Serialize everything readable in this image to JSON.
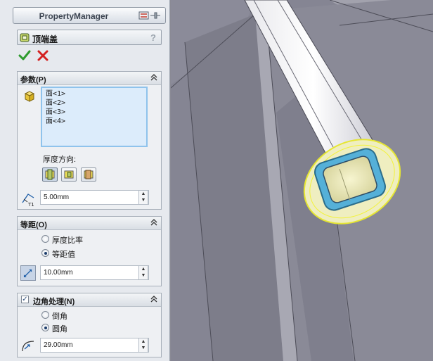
{
  "property_manager": {
    "title": "PropertyManager",
    "feature_title": "顶端盖",
    "help": "?",
    "ok_icon": "checkmark-icon",
    "cancel_icon": "x-icon"
  },
  "params_group": {
    "title": "参数(P)",
    "faces": [
      "面<1>",
      "面<2>",
      "面<3>",
      "面<4>"
    ],
    "thickness_direction_label": "厚度方向:",
    "thickness_value": "5.00mm"
  },
  "offset_group": {
    "title": "等距(O)",
    "option_ratio": "厚度比率",
    "option_value": "等距值",
    "selected": "等距值",
    "offset_value": "10.00mm"
  },
  "corner_group": {
    "title": "边角处理(N)",
    "checked": true,
    "option_chamfer": "倒角",
    "option_fillet": "圆角",
    "selected": "圆角",
    "radius_value": "29.00mm"
  },
  "colors": {
    "panel_bg": "#e6e9ee",
    "selection_list_bg": "#dcecfb",
    "highlight_yellow": "#f2f23a",
    "model_gray": "#8f8f9c"
  }
}
